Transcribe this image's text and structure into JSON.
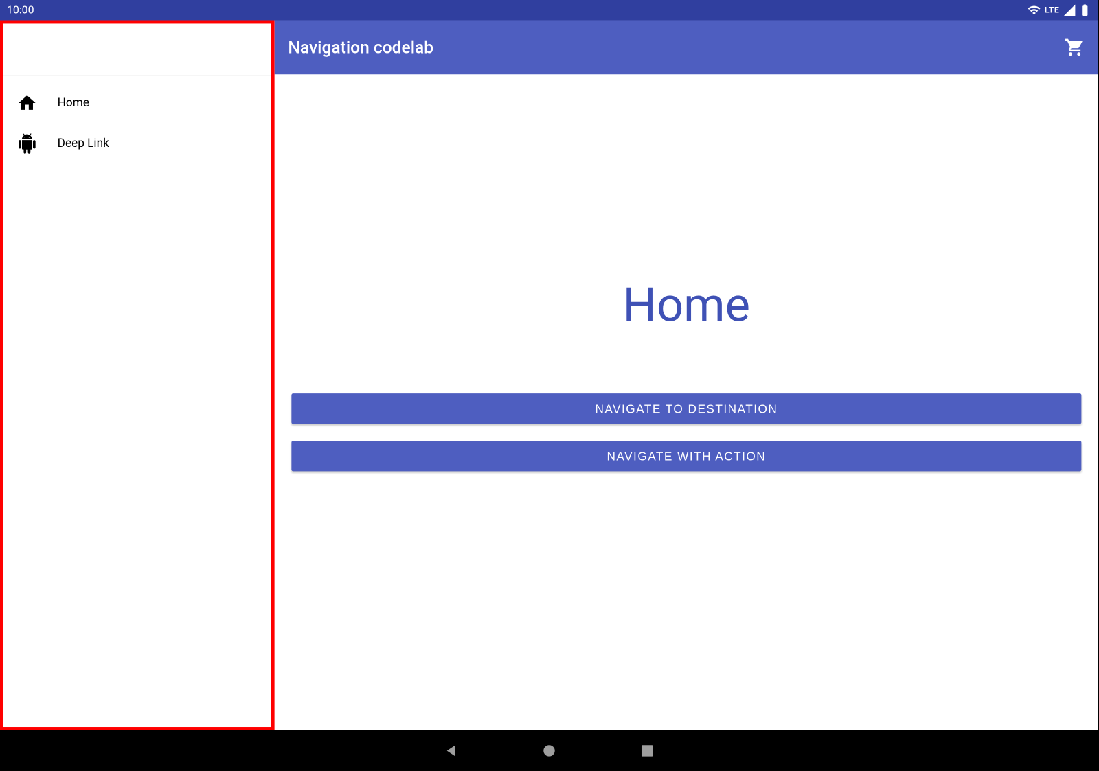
{
  "statusbar": {
    "time": "10:00",
    "network_label": "LTE"
  },
  "appbar": {
    "title": "Navigation codelab"
  },
  "drawer": {
    "items": [
      {
        "label": "Home",
        "icon": "house-icon"
      },
      {
        "label": "Deep Link",
        "icon": "android-icon"
      }
    ]
  },
  "content": {
    "heading": "Home",
    "button1_label": "NAVIGATE TO DESTINATION",
    "button2_label": "NAVIGATE WITH ACTION"
  }
}
